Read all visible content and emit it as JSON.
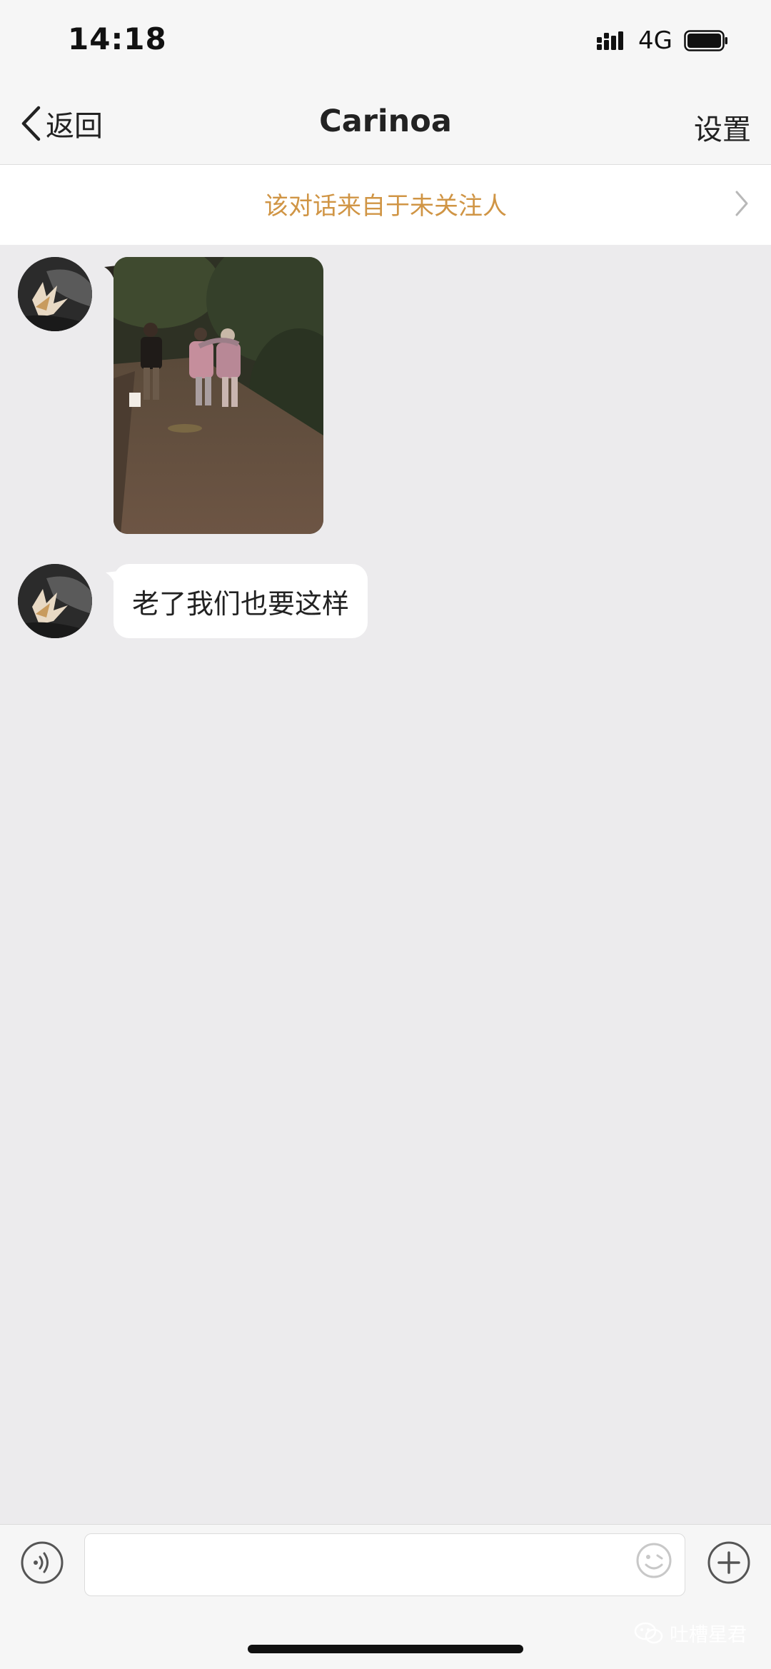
{
  "status_bar": {
    "time": "14:18",
    "network": "4G"
  },
  "nav": {
    "back_label": "返回",
    "title": "Carinoa",
    "settings_label": "设置"
  },
  "notice": {
    "text": "该对话来自于未关注人"
  },
  "messages": [
    {
      "type": "image",
      "description_icon": "photo"
    },
    {
      "type": "text",
      "text": "老了我们也要这样"
    }
  ],
  "watermark": {
    "text": "吐槽星君"
  },
  "colors": {
    "notice": "#d09545",
    "background": "#ecebed",
    "bar": "#f6f6f6"
  }
}
